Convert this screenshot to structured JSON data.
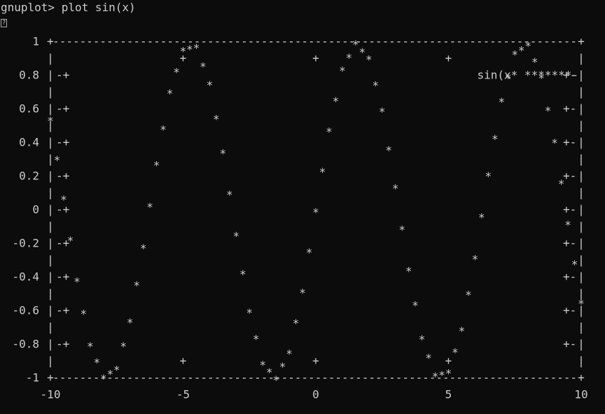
{
  "terminal": {
    "prompt": "gnuplot>",
    "command": "plot sin(x)",
    "unknown_glyph": "?"
  },
  "chart_data": {
    "type": "line",
    "render_style": "ascii dumb terminal",
    "function": "sin(x)",
    "legend": "sin(x* *******-",
    "legend_position": "top-right",
    "xlim": [
      -10,
      10
    ],
    "ylim": [
      -1,
      1
    ],
    "x_ticks": [
      "-10",
      "-5",
      "0",
      "5",
      "10"
    ],
    "y_ticks": [
      "1",
      "0.8",
      "0.6",
      "0.4",
      "0.2",
      "0",
      "-0.2",
      "-0.4",
      "-0.6",
      "-0.8",
      "-1"
    ],
    "mark_char": "*",
    "series": [
      {
        "x": [
          -10,
          -9.5,
          -9,
          -8.5,
          -8,
          -7.5,
          -7,
          -6.5,
          -6,
          -5.5,
          -5,
          -4.5,
          -4,
          -3.5,
          -3,
          -2.5,
          -2,
          -1.5,
          -1,
          -0.5,
          0,
          0.5,
          1,
          1.5,
          2,
          2.5,
          3,
          3.5,
          4,
          4.5,
          5,
          5.5,
          6,
          6.5,
          7,
          7.5,
          8,
          8.5,
          9,
          9.5,
          10
        ],
        "y": [
          0.544,
          0.075,
          -0.412,
          -0.798,
          -0.989,
          -0.938,
          -0.657,
          -0.215,
          0.279,
          0.706,
          0.959,
          0.978,
          0.757,
          0.351,
          -0.141,
          -0.598,
          -0.909,
          -0.997,
          -0.841,
          -0.479,
          0,
          0.479,
          0.841,
          0.997,
          0.909,
          0.598,
          0.141,
          -0.351,
          -0.757,
          -0.978,
          -0.959,
          -0.706,
          -0.279,
          0.215,
          0.657,
          0.938,
          0.989,
          0.798,
          0.412,
          -0.075,
          -0.544
        ]
      }
    ]
  }
}
